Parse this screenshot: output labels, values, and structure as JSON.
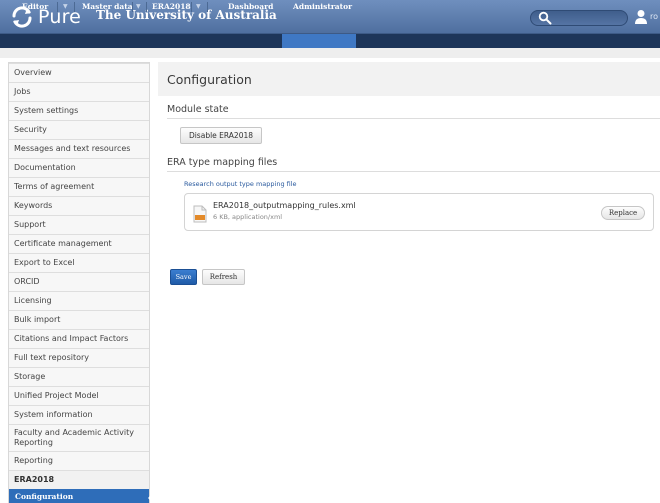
{
  "header": {
    "logo_text": "Pure",
    "university": "The University of Australia",
    "search": {
      "placeholder": ""
    },
    "user_label": "ro"
  },
  "nav": {
    "items": [
      {
        "label": "Editor",
        "has_menu": true
      },
      {
        "label": "Master data",
        "has_menu": true
      },
      {
        "label": "ERA2018",
        "has_menu": true
      },
      {
        "label": "Dashboard",
        "has_menu": false
      },
      {
        "label": "Administrator",
        "has_menu": false
      }
    ],
    "active": "Administrator",
    "caret": "▼"
  },
  "sidebar": {
    "items": [
      {
        "label": "Overview"
      },
      {
        "label": "Jobs"
      },
      {
        "label": "System settings"
      },
      {
        "label": "Security"
      },
      {
        "label": "Messages and text resources"
      },
      {
        "label": "Documentation"
      },
      {
        "label": "Terms of agreement"
      },
      {
        "label": "Keywords"
      },
      {
        "label": "Support"
      },
      {
        "label": "Certificate management"
      },
      {
        "label": "Export to Excel"
      },
      {
        "label": "ORCID"
      },
      {
        "label": "Licensing"
      },
      {
        "label": "Bulk import"
      },
      {
        "label": "Citations and Impact Factors"
      },
      {
        "label": "Full text repository"
      },
      {
        "label": "Storage"
      },
      {
        "label": "Unified Project Model"
      },
      {
        "label": "System information"
      },
      {
        "label": "Faculty and Academic Activity Reporting"
      },
      {
        "label": "Reporting"
      },
      {
        "label": "ERA2018"
      },
      {
        "label": "Configuration"
      }
    ],
    "active": "Configuration"
  },
  "main": {
    "title": "Configuration",
    "module_state": {
      "heading": "Module state",
      "button_label": "Disable ERA2018"
    },
    "mapping": {
      "heading": "ERA type mapping files",
      "sub_label": "Research output type mapping file",
      "file": {
        "name": "ERA2018_outputmapping_rules.xml",
        "meta": "6 KB, application/xml",
        "icon": "xml-file-icon"
      },
      "replace_label": "Replace"
    },
    "actions": {
      "save_label": "Save",
      "refresh_label": "Refresh"
    }
  },
  "colors": {
    "header_bg": "#5f7fb0",
    "nav_bg": "#1d3559",
    "nav_active": "#3f78c4",
    "sidebar_active": "#2e6db9",
    "primary_button": "#2a6cc0",
    "link": "#2a5a9e"
  }
}
